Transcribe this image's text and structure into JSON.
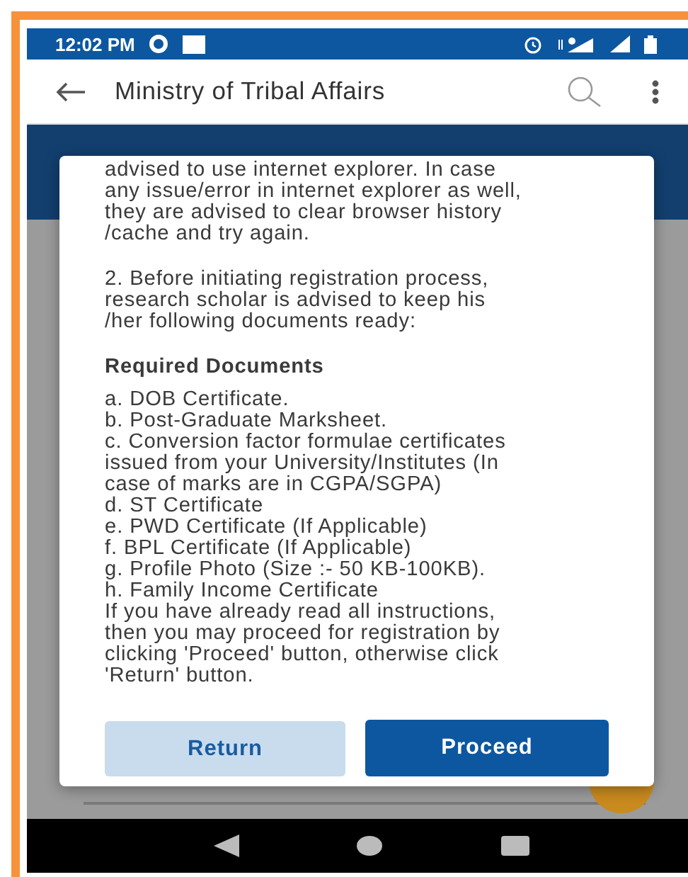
{
  "status_bar": {
    "time": "12:02 PM"
  },
  "app_bar": {
    "title": "Ministry of Tribal Affairs"
  },
  "dialog": {
    "paragraphs": [
      {
        "kind": "text",
        "text": "advised to use internet explorer. In case\nany issue/error in internet explorer as well,\nthey are advised to clear browser history\n/cache and try again."
      },
      {
        "kind": "text",
        "text": "2. Before initiating registration process,\nresearch scholar is advised to keep his\n/her following documents ready:"
      },
      {
        "kind": "heading",
        "text": "Required Documents"
      }
    ],
    "documents": [
      "a. DOB Certificate.",
      "b. Post-Graduate Marksheet.",
      "c. Conversion factor formulae certificates\nissued from your University/Institutes (In\ncase of marks are in CGPA/SGPA)",
      "d. ST Certificate",
      "e. PWD Certificate (If Applicable)",
      "f. BPL Certificate (If Applicable)",
      "g. Profile Photo (Size :- 50 KB-100KB).",
      "h. Family Income Certificate"
    ],
    "closing": "If you have already read all instructions,\nthen you may proceed for registration by\nclicking 'Proceed' button, otherwise click\n'Return' button.",
    "buttons": [
      {
        "label": "Return",
        "kind": "secondary"
      },
      {
        "label": "Proceed",
        "kind": "primary"
      }
    ]
  }
}
